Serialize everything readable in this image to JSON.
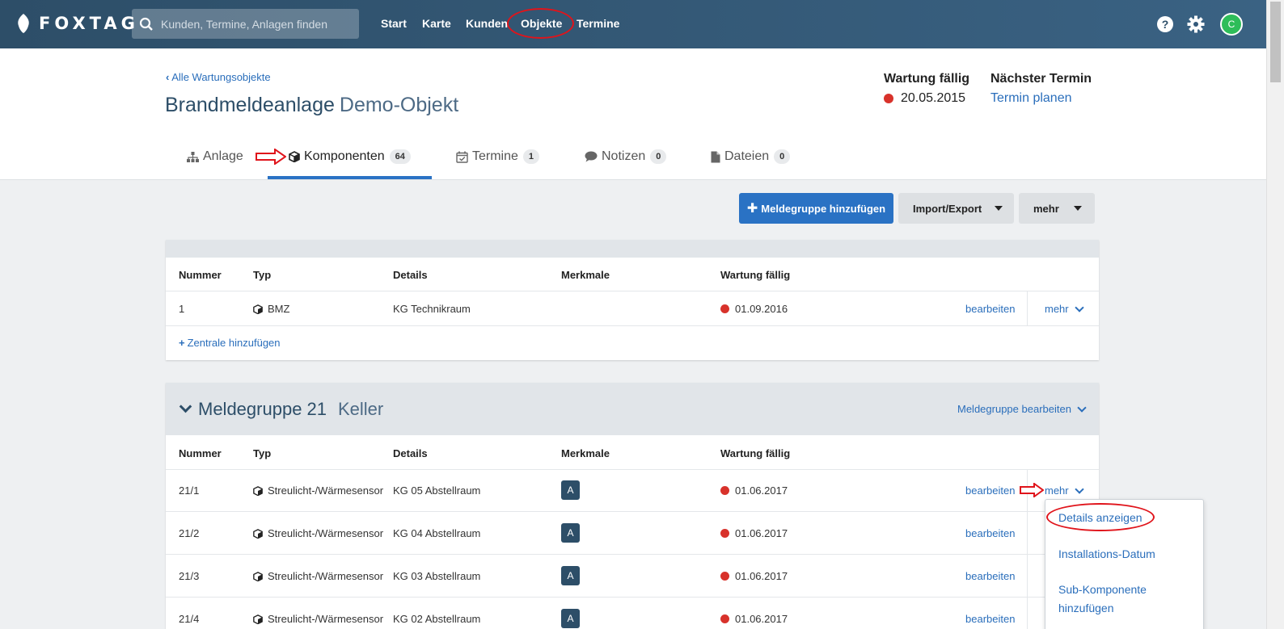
{
  "app": {
    "logo_text": "FOXTAG",
    "search_placeholder": "Kunden, Termine, Anlagen finden",
    "nav": [
      "Start",
      "Karte",
      "Kunden",
      "Objekte",
      "Termine"
    ],
    "active_nav": "Objekte",
    "avatar_initial": "C",
    "icons": {
      "help": "question-circle-icon",
      "settings": "gear-icon"
    },
    "colors": {
      "nav_bar": "#2d4e68",
      "primary": "#2a72c4",
      "link": "#2a6ebb",
      "due_dot": "#d8322b",
      "avatar": "#2ebd59"
    }
  },
  "header": {
    "back_link": "Alle Wartungsobjekte",
    "title": "Brandmeldeanlage",
    "subtitle": "Demo-Objekt",
    "due_label": "Wartung fällig",
    "due_date": "20.05.2015",
    "next_label": "Nächster Termin",
    "next_link": "Termin planen"
  },
  "tabs": [
    {
      "label": "Anlage",
      "icon": "sitemap-icon"
    },
    {
      "label": "Komponenten",
      "icon": "cube-icon",
      "count": "64",
      "active": true
    },
    {
      "label": "Termine",
      "icon": "calendar-check-icon",
      "count": "1"
    },
    {
      "label": "Notizen",
      "icon": "comment-icon",
      "count": "0"
    },
    {
      "label": "Dateien",
      "icon": "file-icon",
      "count": "0"
    }
  ],
  "toolbar": {
    "add_group": "Meldegruppe hinzufügen",
    "import_export": "Import/Export",
    "more": "mehr"
  },
  "table_headers": [
    "Nummer",
    "Typ",
    "Details",
    "Merkmale",
    "Wartung fällig"
  ],
  "central_panel": {
    "rows": [
      {
        "nummer": "1",
        "typ": "BMZ",
        "details": "KG Technikraum",
        "merkmale": "",
        "wartung": "01.09.2016",
        "edit": "bearbeiten",
        "more": "mehr"
      }
    ],
    "add_link": "Zentrale hinzufügen"
  },
  "group_panel": {
    "title": "Meldegruppe 21",
    "subtitle": "Keller",
    "edit_link": "Meldegruppe bearbeiten",
    "rows": [
      {
        "nummer": "21/1",
        "typ": "Streulicht-/Wärmesensor",
        "details": "KG 05 Abstellraum",
        "merkmale": "A",
        "wartung": "01.06.2017",
        "edit": "bearbeiten",
        "more": "mehr"
      },
      {
        "nummer": "21/2",
        "typ": "Streulicht-/Wärmesensor",
        "details": "KG 04 Abstellraum",
        "merkmale": "A",
        "wartung": "01.06.2017",
        "edit": "bearbeiten"
      },
      {
        "nummer": "21/3",
        "typ": "Streulicht-/Wärmesensor",
        "details": "KG 03 Abstellraum",
        "merkmale": "A",
        "wartung": "01.06.2017",
        "edit": "bearbeiten"
      },
      {
        "nummer": "21/4",
        "typ": "Streulicht-/Wärmesensor",
        "details": "KG 02 Abstellraum",
        "merkmale": "A",
        "wartung": "01.06.2017",
        "edit": "bearbeiten"
      }
    ]
  },
  "dropdown": {
    "items": [
      "Details anzeigen",
      "Installations-Datum",
      "Sub-Komponente",
      "hinzufügen"
    ]
  }
}
